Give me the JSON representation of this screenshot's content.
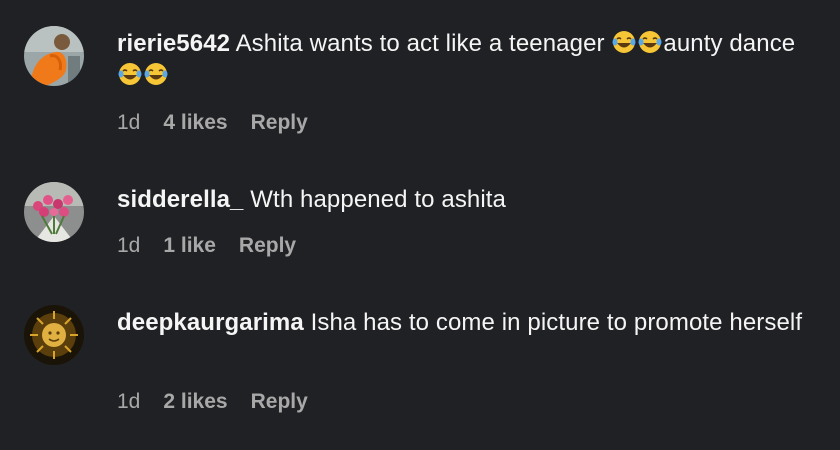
{
  "comments": [
    {
      "username": "rierie5642",
      "text_before": "Ashita wants to act like a teenager ",
      "emoji_1": "😂😂",
      "text_middle": "aunty dance",
      "emoji_2": "😂😂",
      "time": "1d",
      "likes": "4 likes",
      "reply": "Reply",
      "avatar_icon": "avatar-orange-figure-icon"
    },
    {
      "username": "sidderella_",
      "text": "Wth happened to ashita",
      "time": "1d",
      "likes": "1 like",
      "reply": "Reply",
      "avatar_icon": "avatar-pink-roses-icon"
    },
    {
      "username": "deepkaurgarima",
      "text": "Isha has to come in picture to promote herself",
      "time": "1d",
      "likes": "2 likes",
      "reply": "Reply",
      "avatar_icon": "avatar-golden-sun-icon"
    }
  ],
  "colors": {
    "background": "#202124",
    "text": "#f5f5f5",
    "secondary": "#a8a8a8"
  }
}
